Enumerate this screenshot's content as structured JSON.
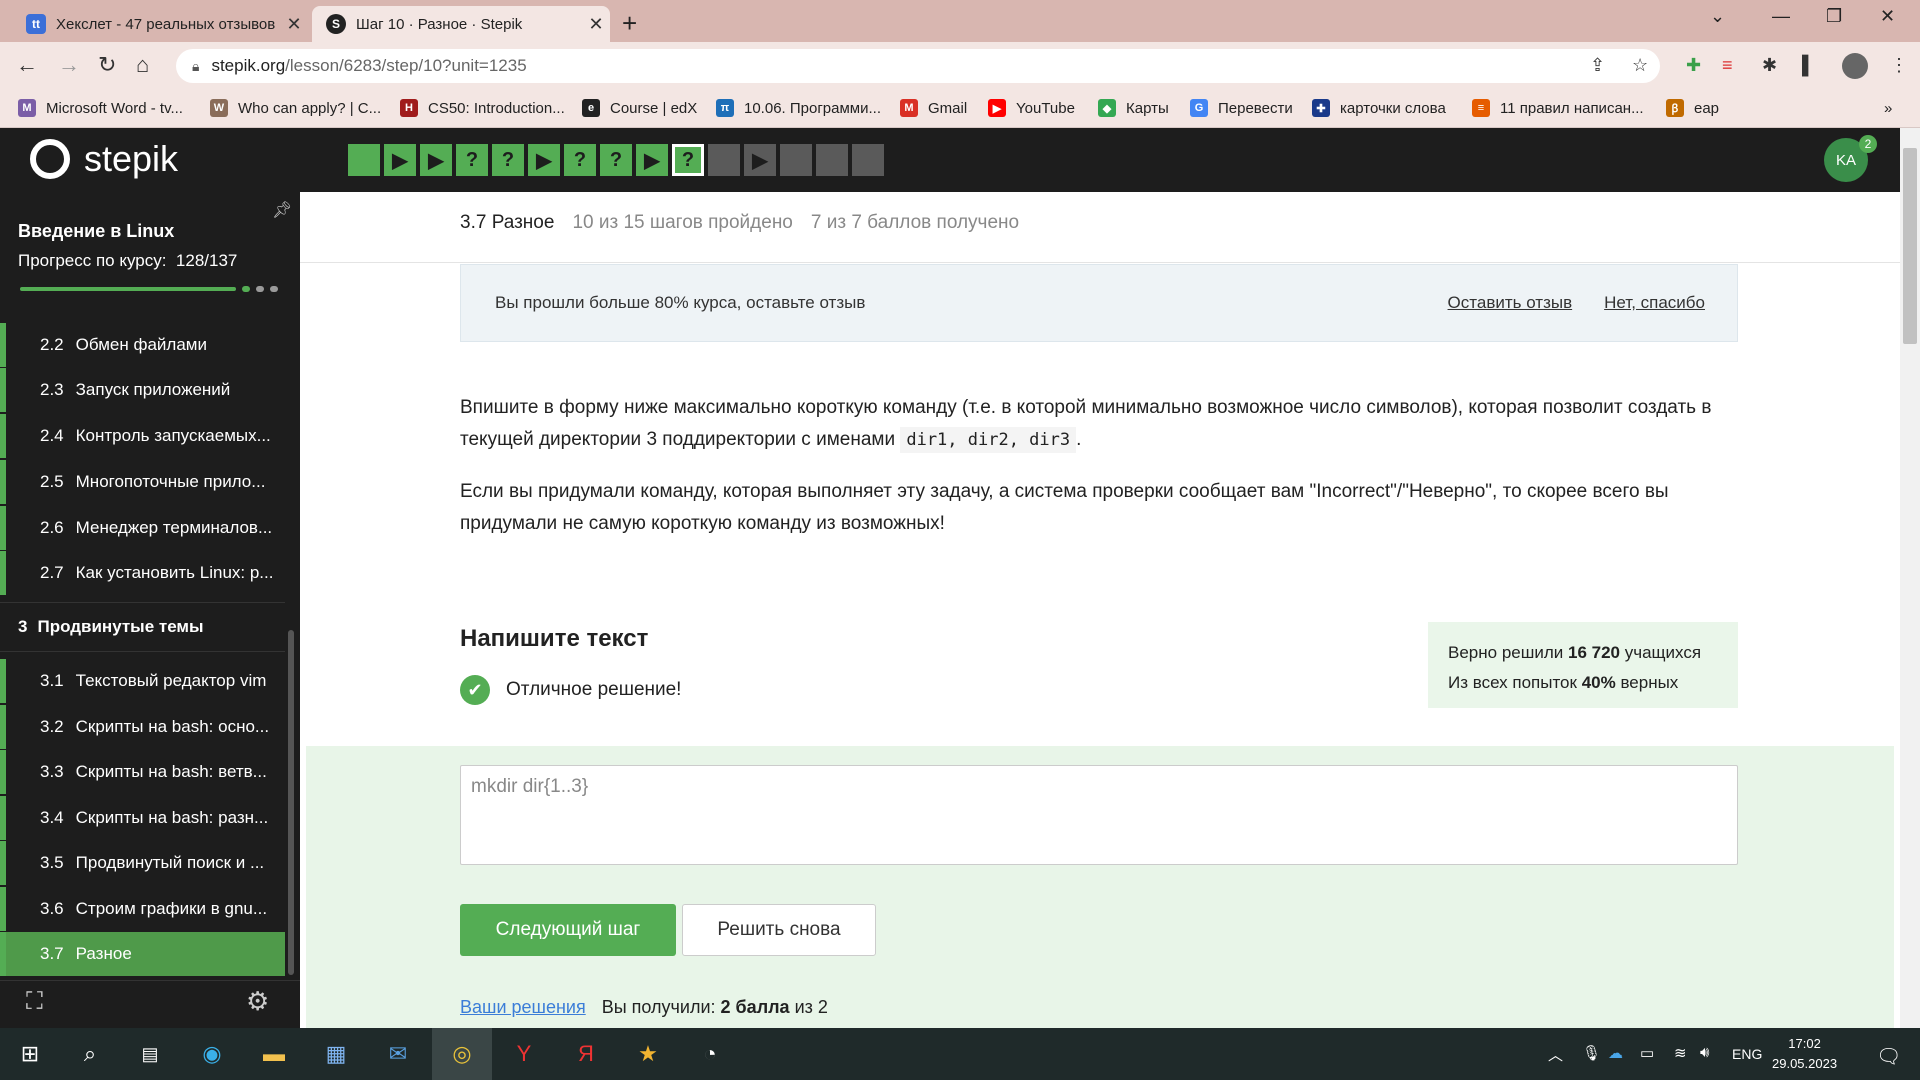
{
  "browser": {
    "tabs": [
      {
        "title": "Хекслет - 47 реальных отзывов",
        "icon_letter": "tt"
      },
      {
        "title": "Шаг 10 · Разное · Stepik"
      }
    ],
    "url_host": "stepik.org",
    "url_path": "/lesson/6283/step/10?unit=1235",
    "bookmarks": [
      {
        "label": "Microsoft Word - tv...",
        "color": "#7b5ea7",
        "glyph": "M"
      },
      {
        "label": "Who can apply? | C...",
        "color": "#8a6d5a",
        "glyph": "W"
      },
      {
        "label": "CS50: Introduction...",
        "color": "#a01c1c",
        "glyph": "H"
      },
      {
        "label": "Course | edX",
        "color": "#222222",
        "glyph": "e"
      },
      {
        "label": "10.06. Программи...",
        "color": "#1e6fb8",
        "glyph": "π"
      },
      {
        "label": "Gmail",
        "color": "#d93025",
        "glyph": "M"
      },
      {
        "label": "YouTube",
        "color": "#ff0000",
        "glyph": "▶"
      },
      {
        "label": "Карты",
        "color": "#34a853",
        "glyph": "◆"
      },
      {
        "label": "Перевести",
        "color": "#4285f4",
        "glyph": "G"
      },
      {
        "label": "карточки слова",
        "color": "#1a3a8a",
        "glyph": "✚"
      },
      {
        "label": "11 правил написан...",
        "color": "#e65c00",
        "glyph": "≡"
      },
      {
        "label": "еар",
        "color": "#c06a00",
        "glyph": "ꞵ"
      }
    ]
  },
  "header": {
    "logo_text": "stepik",
    "avatar_initials": "KA",
    "notification_count": "2",
    "steps": [
      {
        "type": "done",
        "glyph": ""
      },
      {
        "type": "done",
        "glyph": "▶"
      },
      {
        "type": "done",
        "glyph": "▶"
      },
      {
        "type": "done",
        "glyph": "?"
      },
      {
        "type": "done",
        "glyph": "?"
      },
      {
        "type": "done",
        "glyph": "▶"
      },
      {
        "type": "done",
        "glyph": "?"
      },
      {
        "type": "done",
        "glyph": "?"
      },
      {
        "type": "done",
        "glyph": "▶"
      },
      {
        "type": "current",
        "glyph": "?"
      },
      {
        "type": "todo",
        "glyph": ""
      },
      {
        "type": "todo",
        "glyph": "▶"
      },
      {
        "type": "todo",
        "glyph": ""
      },
      {
        "type": "todo",
        "glyph": ""
      },
      {
        "type": "todo",
        "glyph": ""
      }
    ]
  },
  "sidebar": {
    "course_title": "Введение в Linux",
    "progress_label": "Прогресс по курсу:",
    "progress_value": "128/137",
    "progress_fraction": 0.934,
    "lessons_before": [
      {
        "num": "2.2",
        "title": "Обмен файлами"
      },
      {
        "num": "2.3",
        "title": "Запуск приложений"
      },
      {
        "num": "2.4",
        "title": "Контроль запускаемых..."
      },
      {
        "num": "2.5",
        "title": "Многопоточные прило..."
      },
      {
        "num": "2.6",
        "title": "Менеджер терминалов..."
      },
      {
        "num": "2.7",
        "title": "Как установить Linux: р..."
      }
    ],
    "section": {
      "num": "3",
      "title": "Продвинутые темы"
    },
    "lessons_after": [
      {
        "num": "3.1",
        "title": "Текстовый редактор vim"
      },
      {
        "num": "3.2",
        "title": "Скрипты на bash: осно..."
      },
      {
        "num": "3.3",
        "title": "Скрипты на bash: ветв..."
      },
      {
        "num": "3.4",
        "title": "Скрипты на bash: разн..."
      },
      {
        "num": "3.5",
        "title": "Продвинутый поиск и ..."
      },
      {
        "num": "3.6",
        "title": "Строим графики в gnu..."
      },
      {
        "num": "3.7",
        "title": "Разное"
      }
    ]
  },
  "lesson_header": {
    "title": "3.7 Разное",
    "steps_done": "10 из 15 шагов пройдено",
    "points": "7 из 7 баллов  получено"
  },
  "banner": {
    "text": "Вы прошли больше 80% курса, оставьте отзыв",
    "leave_review": "Оставить отзыв",
    "no_thanks": "Нет, спасибо"
  },
  "task": {
    "p1_a": "Впишите в форму ниже максимально короткую команду (т.е. в которой минимально возможное число символов), которая позволит создать в текущей директории 3 поддиректории с именами ",
    "p1_code": "dir1, dir2, dir3",
    "p1_b": ".",
    "p2": "Если вы придумали команду, которая выполняет эту задачу, а система проверки сообщает вам \"Incorrect\"/\"Неверно\", то скорее всего вы придумали не самую короткую команду из возможных!",
    "heading": "Напишите текст",
    "success": "Отличное решение!",
    "stats_solved_prefix": "Верно решили ",
    "stats_solved_count": "16 720",
    "stats_solved_suffix": " учащихся",
    "stats_attempts_prefix": "Из всех попыток ",
    "stats_attempts_pct": "40%",
    "stats_attempts_suffix": " верных",
    "answer": "mkdir dir{1..3}",
    "next_button": "Следующий шаг",
    "retry_button": "Решить снова",
    "your_solutions": "Ваши решения",
    "got_prefix": "Вы получили: ",
    "got_score": "2 балла",
    "got_suffix": " из 2"
  },
  "taskbar": {
    "lang": "ENG",
    "time": "17:02",
    "date": "29.05.2023"
  }
}
